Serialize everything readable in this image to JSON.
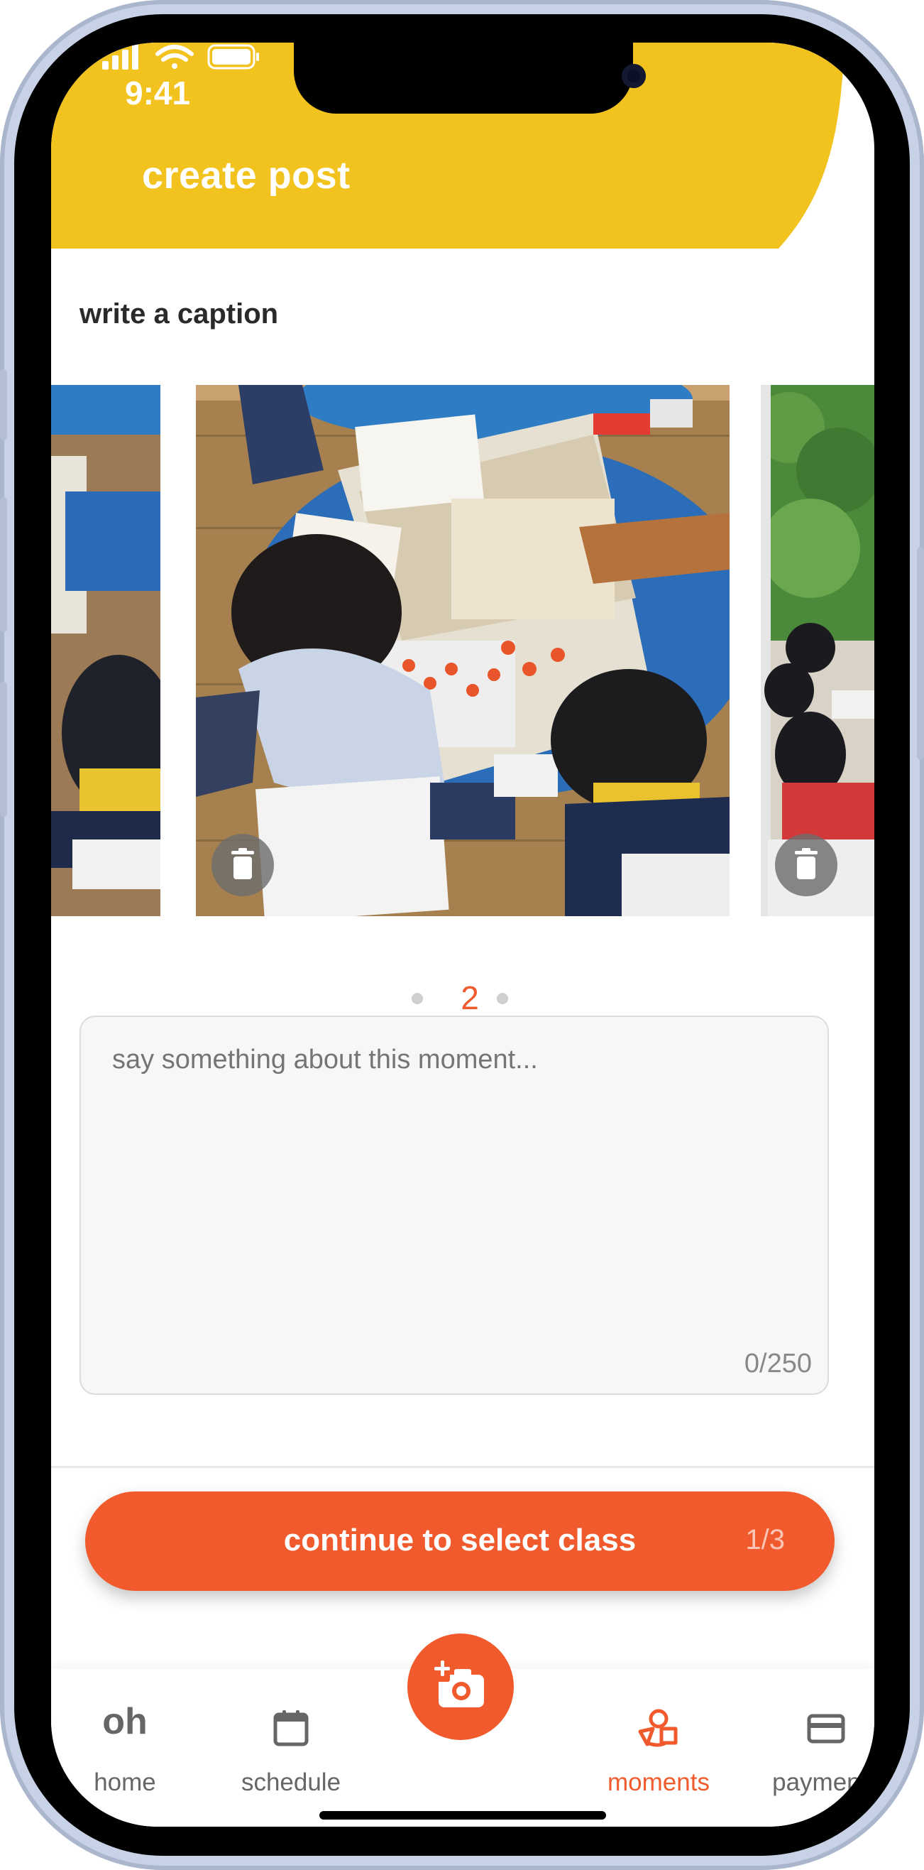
{
  "status_bar": {
    "time": "9:41"
  },
  "header": {
    "title": "create post"
  },
  "caption_section": {
    "label": "write a caption"
  },
  "carousel": {
    "current_page": "2"
  },
  "caption": {
    "placeholder": "say something about this moment...",
    "counter": "0/250"
  },
  "continue_button": {
    "label": "continue to select class",
    "step": "1/3"
  },
  "tabbar": {
    "home": {
      "logo": "oh",
      "label": "home"
    },
    "schedule": {
      "label": "schedule"
    },
    "moments": {
      "label": "moments"
    },
    "payments": {
      "label": "payments"
    }
  },
  "colors": {
    "header_yellow": "#f2c31e",
    "accent": "#f05a2c"
  },
  "icons": [
    "back-arrow-icon",
    "trash-icon",
    "calendar-icon",
    "moments-icon",
    "card-icon",
    "add-camera-icon"
  ]
}
